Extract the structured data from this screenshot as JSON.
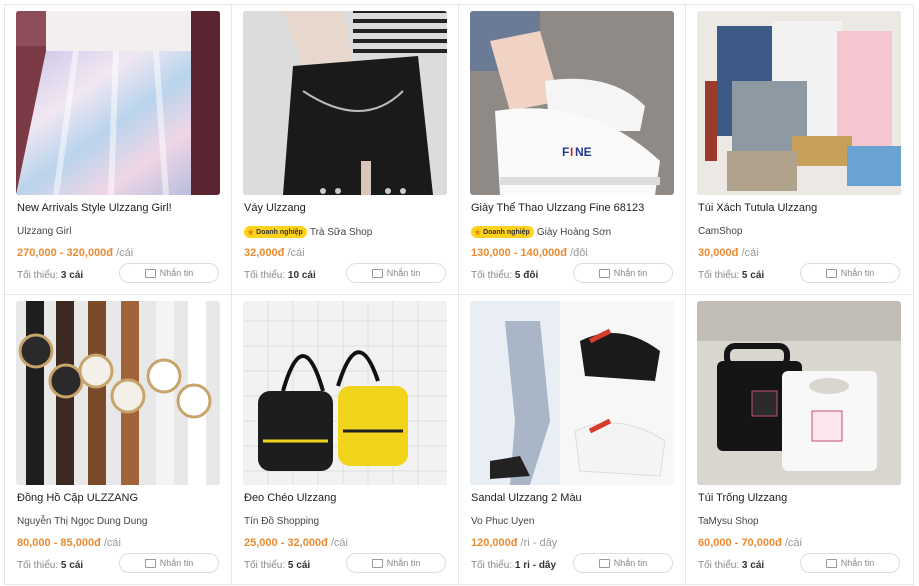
{
  "products": [
    {
      "title": "New Arrivals Style Ulzzang Girl!",
      "shop": "Ulzzang Girl",
      "business_badge": "",
      "price": "270,000 - 320,000đ",
      "unit": "/cái",
      "min_label": "Tối thiểu:",
      "min_value": "3 cái",
      "message_label": "Nhắn tin",
      "image": "holographic-skirt-photo"
    },
    {
      "title": "Váy Ulzzang",
      "shop": "Trà Sữa Shop",
      "business_badge": "Doanh nghiệp",
      "price": "32,000đ",
      "unit": "/cái",
      "min_label": "Tối thiểu:",
      "min_value": "10 cái",
      "message_label": "Nhắn tin",
      "image": "black-skirt-photo"
    },
    {
      "title": "Giày Thể Thao Ulzzang Fine 68123",
      "shop": "Giày Hoàng Sơn",
      "business_badge": "Doanh nghiệp",
      "price": "130,000 - 140,000đ",
      "unit": "/đôi",
      "min_label": "Tối thiểu:",
      "min_value": "5 đôi",
      "message_label": "Nhắn tin",
      "image": "white-sneakers-photo"
    },
    {
      "title": "Túi Xách Tutula Ulzzang",
      "shop": "CamShop",
      "business_badge": "",
      "price": "30,000đ",
      "unit": "/cái",
      "min_label": "Tối thiểu:",
      "min_value": "5 cái",
      "message_label": "Nhắn tin",
      "image": "tutula-bags-photo"
    },
    {
      "title": "Đồng Hồ Cặp ULZZANG",
      "shop": "Nguyễn Thị Ngọc Dung Dung",
      "business_badge": "",
      "price": "80,000 - 85,000đ",
      "unit": "/cái",
      "min_label": "Tối thiểu:",
      "min_value": "5 cái",
      "message_label": "Nhắn tin",
      "image": "watches-photo"
    },
    {
      "title": "Đeo Chéo Ulzzang",
      "shop": "Tín Đồ Shopping",
      "business_badge": "",
      "price": "25,000 - 32,000đ",
      "unit": "/cái",
      "min_label": "Tối thiểu:",
      "min_value": "5 cái",
      "message_label": "Nhắn tin",
      "image": "backpacks-photo"
    },
    {
      "title": "Sandal Ulzzang 2 Màu",
      "shop": "Vo Phuc Uyen",
      "business_badge": "",
      "price": "120,000đ",
      "unit": "/ri - dây",
      "min_label": "Tối thiểu:",
      "min_value": "1 ri - dây",
      "message_label": "Nhắn tin",
      "image": "sandals-photo"
    },
    {
      "title": "Túi Trống Ulzzang",
      "shop": "TaMysu Shop",
      "business_badge": "",
      "price": "60,000 - 70,000đ",
      "unit": "/cái",
      "min_label": "Tối thiểu:",
      "min_value": "3 cái",
      "message_label": "Nhắn tin",
      "image": "cake-bags-photo"
    }
  ],
  "colors": {
    "price": "#e98b2f",
    "border": "#e6e6e6",
    "badge": "#ffd21e"
  }
}
